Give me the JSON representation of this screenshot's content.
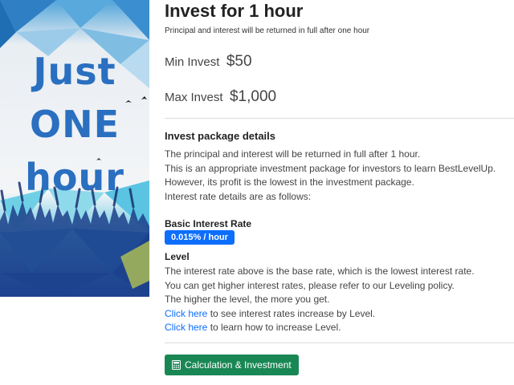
{
  "banner": {
    "words": [
      "Just",
      "ONE",
      "hour"
    ]
  },
  "package": {
    "title": "Invest for 1 hour",
    "subtitle": "Principal and interest will be returned in full after one hour",
    "min_label": "Min Invest",
    "min_value": "$50",
    "max_label": "Max Invest",
    "max_value": "$1,000"
  },
  "details": {
    "heading": "Invest package details",
    "lines": [
      "The principal and interest will be returned in full after 1 hour.",
      "This is an appropriate investment package for investors to learn BestLevelUp.",
      "However, its profit is the lowest in the investment package.",
      "Interest rate details are as follows:"
    ],
    "basic_rate_heading": "Basic Interest Rate",
    "basic_rate_badge": "0.015% / hour",
    "level_heading": "Level",
    "level_lines": [
      "The interest rate above is the base rate, which is the lowest interest rate.",
      "You can get higher interest rates, please refer to our Leveling policy.",
      "The higher the level, the more you get."
    ],
    "link1_text": "Click here",
    "link1_rest": " to see interest rates increase by Level.",
    "link2_text": "Click here",
    "link2_rest": " to learn how to increase Level."
  },
  "actions": {
    "calc_button": "Calculation & Investment",
    "calc_icon": "calculator-icon"
  },
  "colors": {
    "badge_blue": "#0d6efd",
    "link_blue": "#0d6efd",
    "button_green": "#198754",
    "banner_text": "#2a6fc0"
  }
}
